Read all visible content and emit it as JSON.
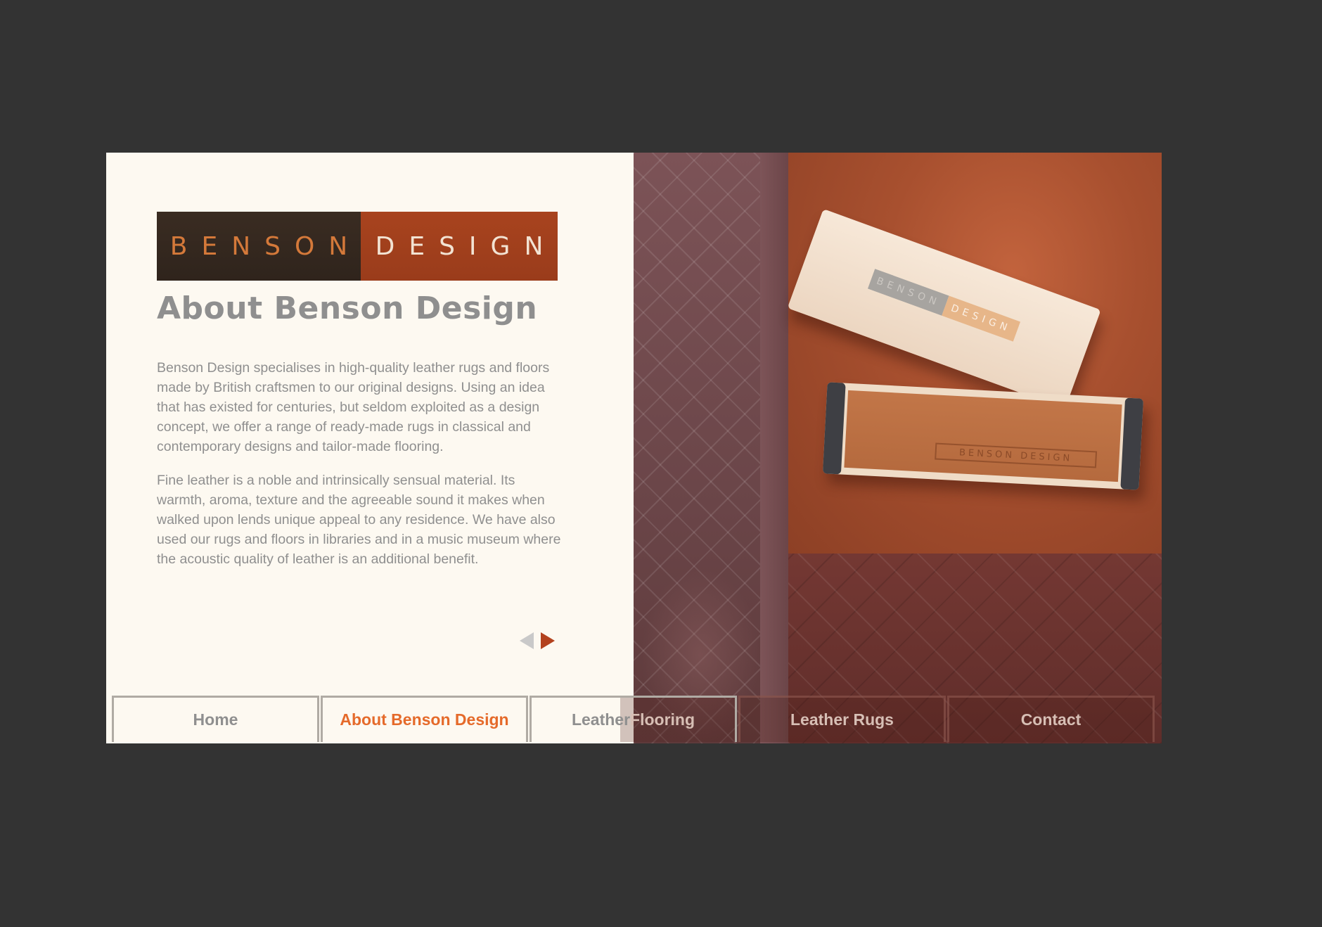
{
  "logo": {
    "left_word": "BENSON",
    "right_word": "DESIGN",
    "left_bg": "#3a2c22",
    "right_bg": "#a8431e"
  },
  "page": {
    "title": "About Benson Design",
    "paragraphs": [
      "Benson Design specialises in high-quality leather rugs and floors made by British craftsmen to our original designs. Using an idea that has existed for centuries, but seldom exploited as a design concept, we offer a range of ready-made rugs in classical and contemporary designs and tailor-made flooring.",
      "Fine leather is a noble and intrinsically sensual material. Its warmth, aroma, texture and the agreeable sound it makes when walked upon lends unique appeal to any residence. We have also used our rugs and floors in libraries and in a music museum where the acoustic quality of leather is an additional benefit."
    ]
  },
  "pager": {
    "prev_icon": "arrow-left-icon",
    "next_icon": "arrow-right-icon"
  },
  "photo": {
    "box_lid_left": "BENSON",
    "box_lid_right": "DESIGN",
    "tray_stamp": "BENSON DESIGN"
  },
  "nav": {
    "items": [
      {
        "label": "Home",
        "active": false
      },
      {
        "label": "About Benson Design",
        "active": true
      },
      {
        "label_part1": "Leather",
        "label_part2": " Flooring",
        "active": false
      },
      {
        "label": "Leather Rugs",
        "active": false
      },
      {
        "label": "Contact",
        "active": false
      }
    ]
  },
  "colors": {
    "background": "#333333",
    "panel": "#fdf9f1",
    "text_grey": "#8f8f8f",
    "accent_orange": "#e56a2a",
    "arrow_active": "#b3421e",
    "arrow_inactive": "#c9c9c9"
  }
}
